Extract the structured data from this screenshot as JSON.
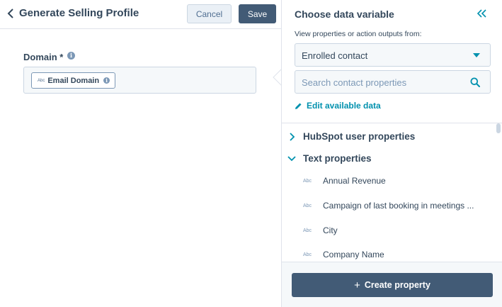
{
  "header": {
    "title": "Generate Selling Profile",
    "cancel_label": "Cancel",
    "save_label": "Save"
  },
  "field": {
    "label": "Domain *",
    "token": {
      "type": "Abc",
      "label": "Email Domain"
    }
  },
  "panel": {
    "title": "Choose data variable",
    "view_label": "View properties or action outputs from:",
    "source_select": {
      "value": "Enrolled contact"
    },
    "search": {
      "placeholder": "Search contact properties",
      "value": ""
    },
    "edit_link": "Edit available data",
    "groups": [
      {
        "label": "HubSpot user properties",
        "expanded": false
      },
      {
        "label": "Text properties",
        "expanded": true
      }
    ],
    "properties": [
      {
        "type": "Abc",
        "label": "Annual Revenue"
      },
      {
        "type": "Abc",
        "label": "Campaign of last booking in meetings ..."
      },
      {
        "type": "Abc",
        "label": "City"
      },
      {
        "type": "Abc",
        "label": "Company Name"
      }
    ],
    "create_label": "Create property"
  },
  "colors": {
    "accent": "#0091ae",
    "primary_button": "#425b76",
    "text": "#33475b"
  },
  "icons": [
    "chevron-left-icon",
    "info-icon",
    "double-chevron-left-icon",
    "caret-down-icon",
    "search-icon",
    "pencil-icon",
    "chevron-right-icon",
    "chevron-down-icon",
    "plus-icon"
  ]
}
